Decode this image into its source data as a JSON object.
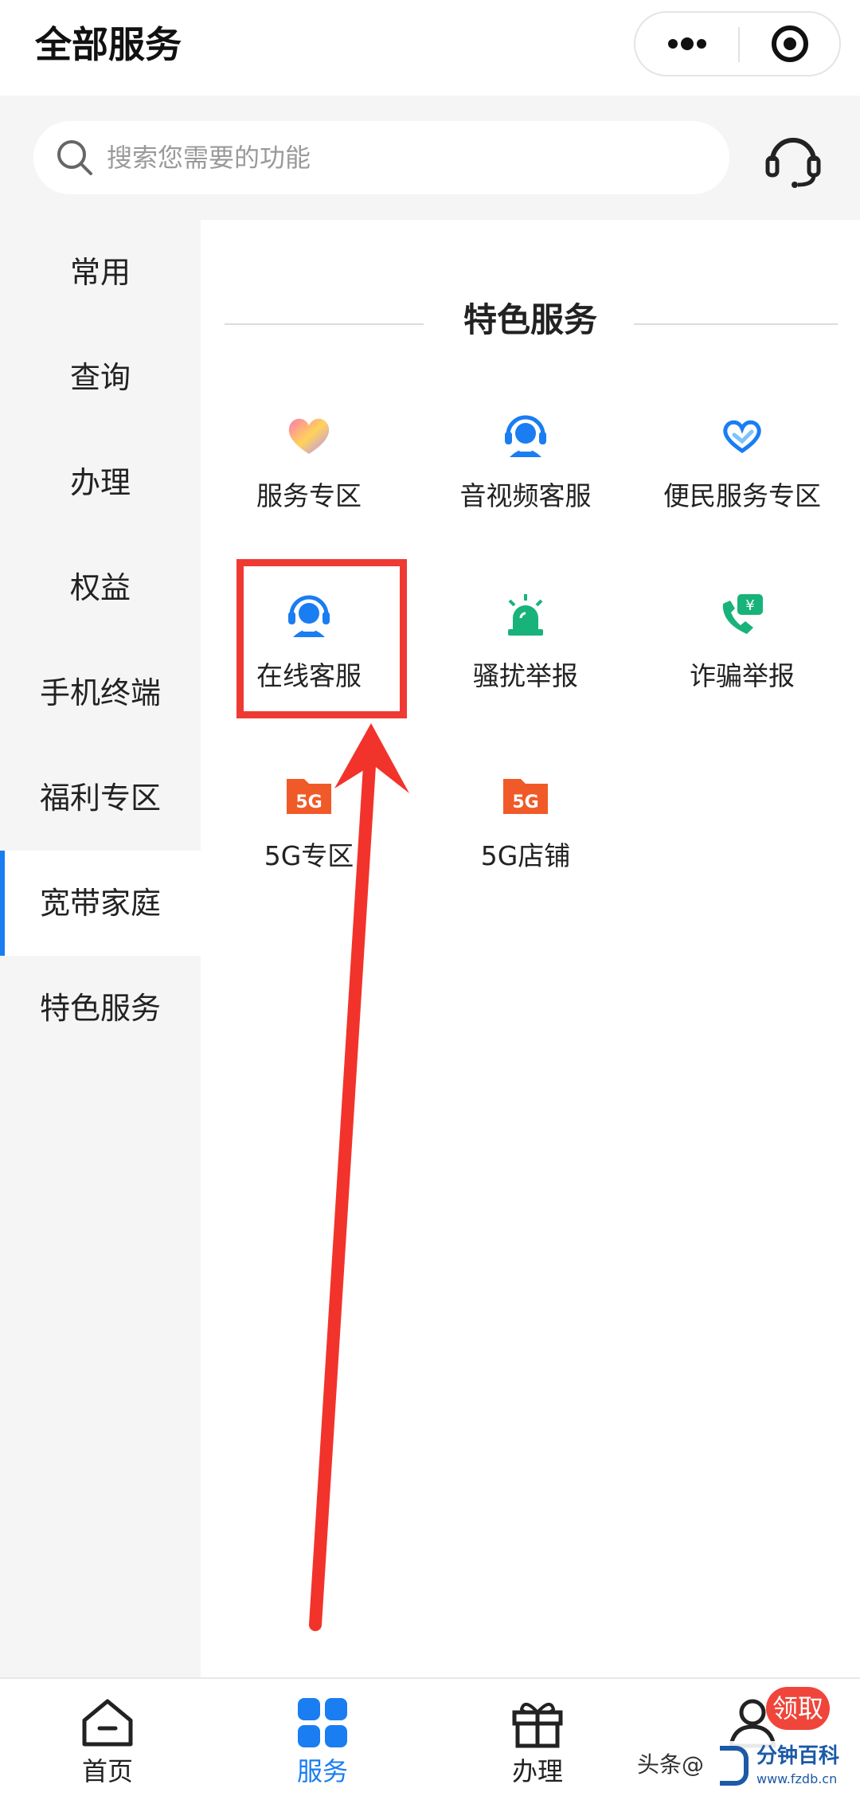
{
  "header": {
    "title": "全部服务"
  },
  "search": {
    "placeholder": "搜索您需要的功能"
  },
  "sidebar": {
    "items": [
      {
        "label": "常用"
      },
      {
        "label": "查询"
      },
      {
        "label": "办理"
      },
      {
        "label": "权益"
      },
      {
        "label": "手机终端"
      },
      {
        "label": "福利专区"
      },
      {
        "label": "宽带家庭",
        "active": true
      },
      {
        "label": "特色服务"
      }
    ]
  },
  "section": {
    "title": "特色服务",
    "items": [
      {
        "label": "服务专区",
        "icon": "heart-gradient-icon"
      },
      {
        "label": "音视频客服",
        "icon": "headset-agent-icon"
      },
      {
        "label": "便民服务专区",
        "icon": "handshake-heart-icon"
      },
      {
        "label": "在线客服",
        "icon": "headset-agent-icon"
      },
      {
        "label": "骚扰举报",
        "icon": "alarm-siren-icon"
      },
      {
        "label": "诈骗举报",
        "icon": "phone-yen-icon"
      },
      {
        "label": "5G专区",
        "icon": "5g-folder-icon"
      },
      {
        "label": "5G店铺",
        "icon": "5g-folder-icon"
      }
    ]
  },
  "icon_text": {
    "five_g": "5G",
    "yen": "¥"
  },
  "tabbar": {
    "items": [
      {
        "label": "首页",
        "icon": "home-icon"
      },
      {
        "label": "服务",
        "icon": "grid-apps-icon",
        "active": true
      },
      {
        "label": "办理",
        "icon": "gift-icon"
      },
      {
        "label": "",
        "icon": "user-icon"
      }
    ],
    "badge": "领取"
  },
  "watermark": {
    "text": "头条@",
    "brand": "分钟百科",
    "url": "www.fzdb.cn"
  },
  "colors": {
    "accent": "#1a7df2",
    "highlight": "#ee3a33",
    "green": "#18b37a",
    "orange": "#f05a28"
  }
}
